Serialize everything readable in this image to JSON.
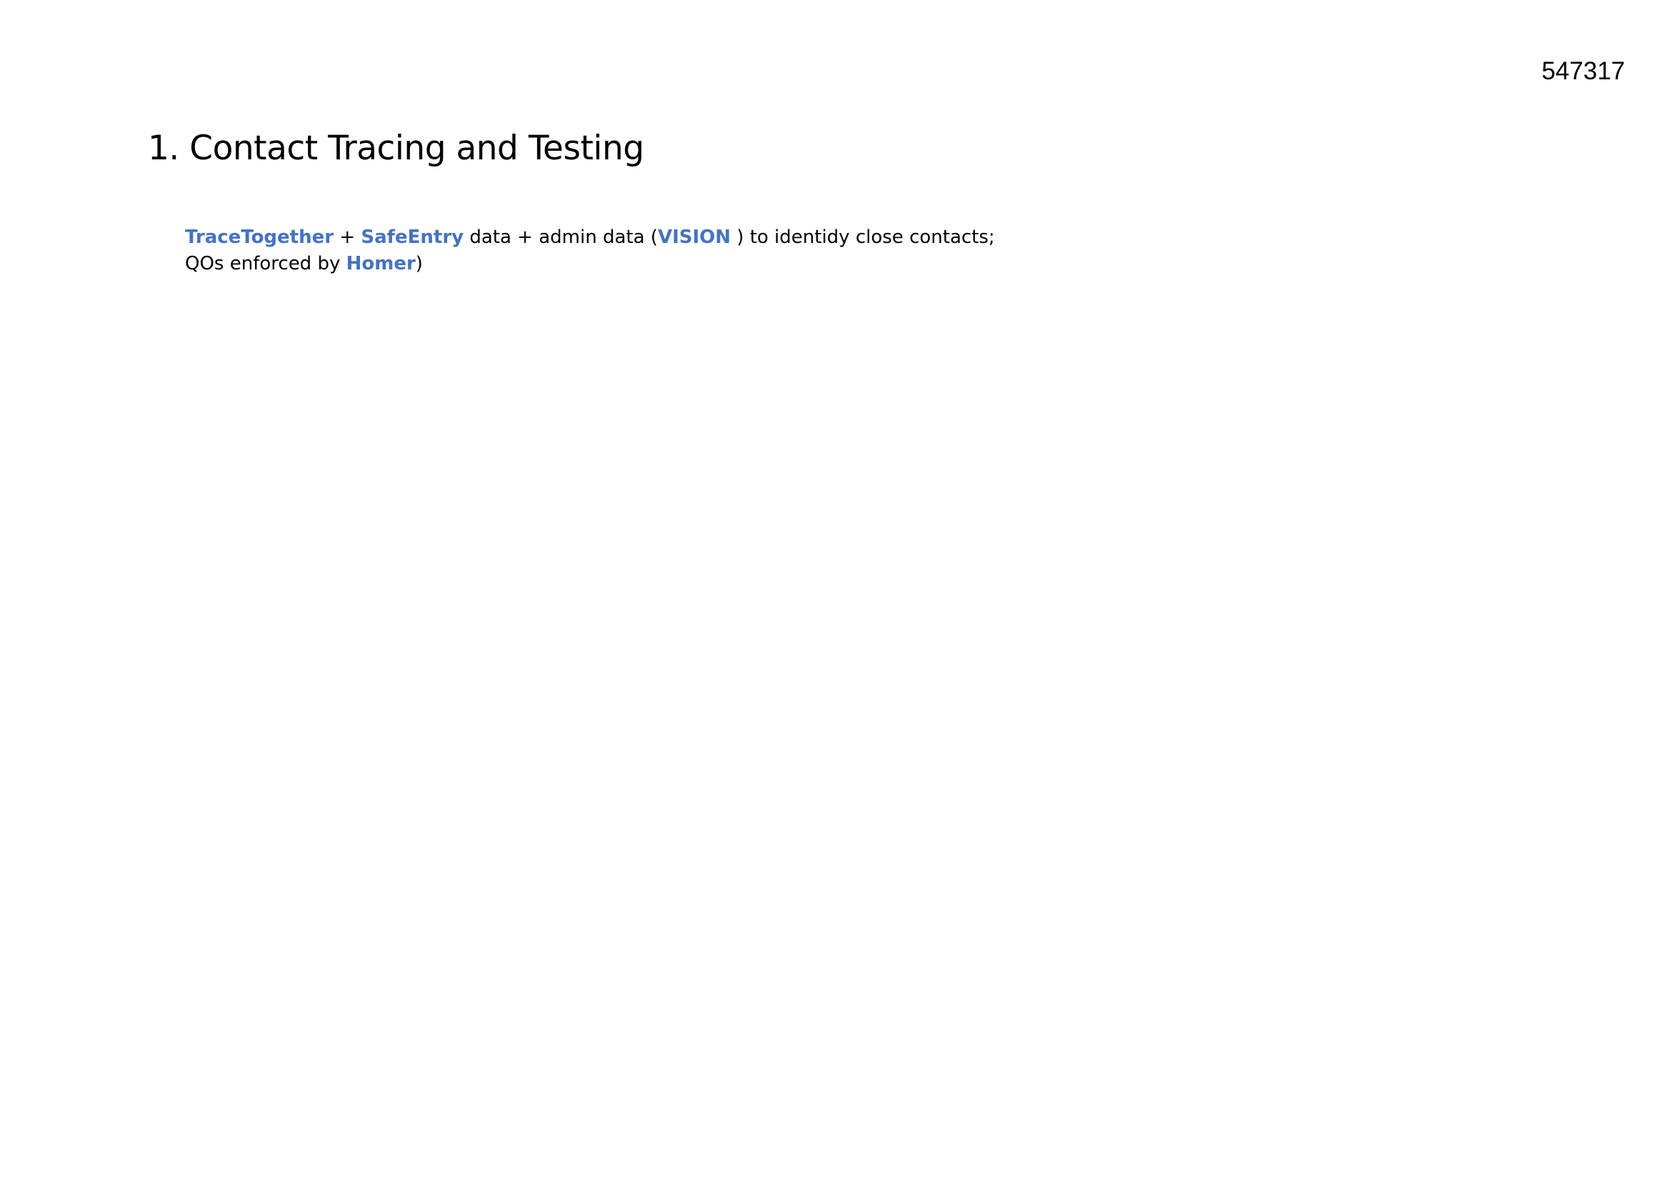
{
  "document": {
    "doc_id": "547317",
    "heading": "1. Contact Tracing and Testing",
    "paragraph": {
      "line1": {
        "term1": "TraceTogether",
        "sep1": " + ",
        "term2": "SafeEntry",
        "text2": " data +  admin data (",
        "term3": "VISION",
        "text3": " ) to identidy close contacts;"
      },
      "line2": {
        "text1": "QOs enforced by ",
        "term1": "Homer",
        "text2": ")"
      }
    },
    "colors": {
      "highlight": "#4472c4",
      "text": "#000000",
      "background": "#ffffff"
    }
  }
}
